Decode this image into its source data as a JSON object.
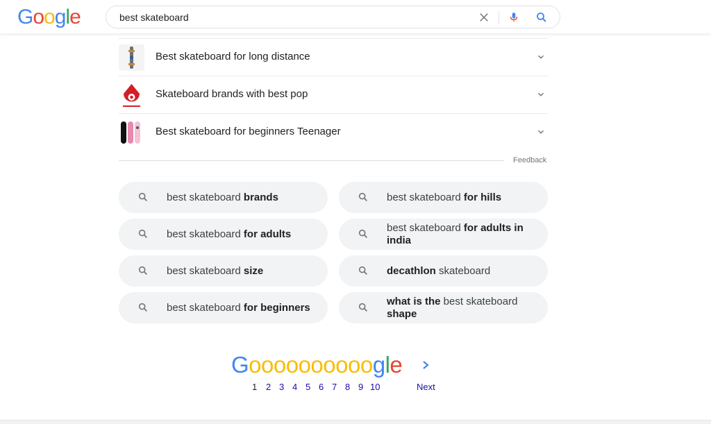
{
  "header": {
    "logo_letters": [
      "G",
      "o",
      "o",
      "g",
      "l",
      "e"
    ],
    "logo_colors": [
      "#4285F4",
      "#EA4335",
      "#FBBC05",
      "#4285F4",
      "#34A853",
      "#EA4335"
    ],
    "search_value": "best skateboard"
  },
  "questions": [
    {
      "text": "Best skateboard for long distance",
      "icon": "skateboard-thumbnail"
    },
    {
      "text": "Skateboard brands with best pop",
      "icon": "brand-logo-thumbnail"
    },
    {
      "text": "Best skateboard for beginners Teenager",
      "icon": "skateboard-decks-thumbnail"
    }
  ],
  "feedback_label": "Feedback",
  "related": {
    "left": [
      {
        "plain": "best skateboard ",
        "bold": "brands"
      },
      {
        "plain": "best skateboard ",
        "bold": "for adults"
      },
      {
        "plain": "best skateboard ",
        "bold": "size"
      },
      {
        "plain": "best skateboard ",
        "bold": "for beginners"
      }
    ],
    "right": [
      {
        "pre_bold": "",
        "plain": "best skateboard ",
        "bold": "for hills"
      },
      {
        "pre_bold": "",
        "plain": "best skateboard ",
        "bold": "for adults in india"
      },
      {
        "pre_bold": "decathlon",
        "plain": " skateboard",
        "bold": ""
      },
      {
        "pre_bold": "what is the",
        "plain": " best skateboard ",
        "bold": "shape"
      }
    ]
  },
  "pager": {
    "logo_G": "G",
    "logo_os": "oooooooooo",
    "logo_g": "g",
    "logo_l": "l",
    "logo_e": "e",
    "pages": [
      "1",
      "2",
      "3",
      "4",
      "5",
      "6",
      "7",
      "8",
      "9",
      "10"
    ],
    "current": "1",
    "next_label": "Next"
  },
  "colors": {
    "blue": "#4285F4",
    "red": "#EA4335",
    "yellow": "#FBBC05",
    "green": "#34A853",
    "link": "#1a0dab"
  }
}
